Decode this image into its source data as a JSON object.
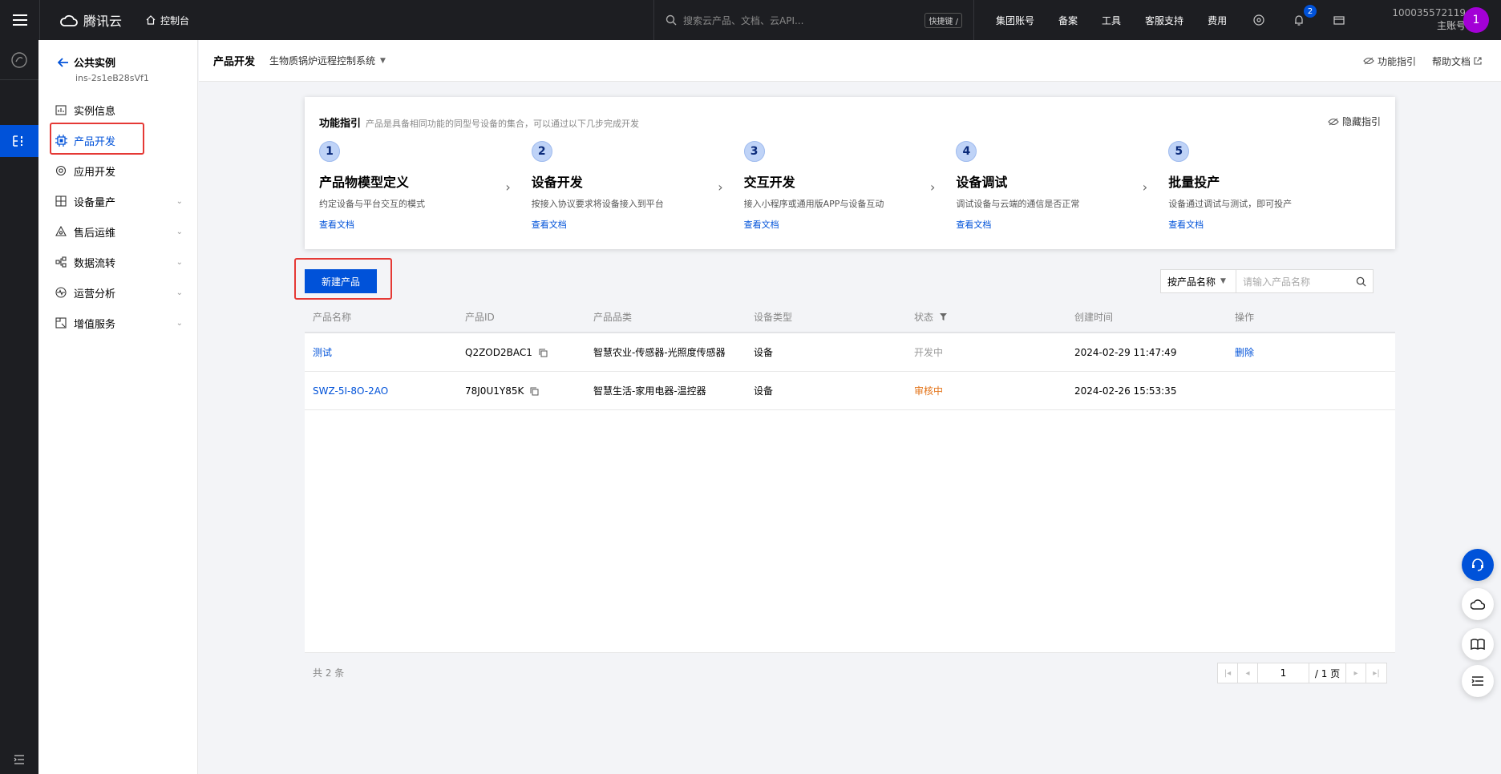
{
  "topbar": {
    "brand": "腾讯云",
    "console": "控制台",
    "search_placeholder": "搜索云产品、文档、云API...",
    "shortcut": "快捷键 /",
    "links": [
      "集团账号",
      "备案",
      "工具",
      "客服支持",
      "费用"
    ],
    "notification_count": "2",
    "account_id": "100035572119",
    "account_type": "主账号",
    "avatar_initial": "1"
  },
  "sidebar": {
    "title": "公共实例",
    "instance_id": "ins-2s1eB28sVf1",
    "items": [
      {
        "label": "实例信息",
        "icon": "chart-icon",
        "expandable": false
      },
      {
        "label": "产品开发",
        "icon": "chip-icon",
        "expandable": false,
        "active": true
      },
      {
        "label": "应用开发",
        "icon": "gear-icon",
        "expandable": false
      },
      {
        "label": "设备量产",
        "icon": "grid-icon",
        "expandable": true
      },
      {
        "label": "售后运维",
        "icon": "maintenance-icon",
        "expandable": true
      },
      {
        "label": "数据流转",
        "icon": "flow-icon",
        "expandable": true
      },
      {
        "label": "运营分析",
        "icon": "pulse-icon",
        "expandable": true
      },
      {
        "label": "增值服务",
        "icon": "service-icon",
        "expandable": true
      }
    ]
  },
  "header": {
    "title": "产品开发",
    "project": "生物质锅炉远程控制系统",
    "guide_link": "功能指引",
    "help_link": "帮助文档"
  },
  "guide": {
    "title": "功能指引",
    "desc": "产品是具备相同功能的同型号设备的集合，可以通过以下几步完成开发",
    "hide": "隐藏指引",
    "steps": [
      {
        "num": "1",
        "title": "产品物模型定义",
        "desc": "约定设备与平台交互的模式",
        "link": "查看文档"
      },
      {
        "num": "2",
        "title": "设备开发",
        "desc": "按接入协议要求将设备接入到平台",
        "link": "查看文档"
      },
      {
        "num": "3",
        "title": "交互开发",
        "desc": "接入小程序或通用版APP与设备互动",
        "link": "查看文档"
      },
      {
        "num": "4",
        "title": "设备调试",
        "desc": "调试设备与云端的通信是否正常",
        "link": "查看文档"
      },
      {
        "num": "5",
        "title": "批量投产",
        "desc": "设备通过调试与测试，即可投产",
        "link": "查看文档"
      }
    ]
  },
  "toolbar": {
    "new_product": "新建产品",
    "filter_select": "按产品名称",
    "filter_placeholder": "请输入产品名称"
  },
  "table": {
    "columns": [
      "产品名称",
      "产品ID",
      "产品品类",
      "设备类型",
      "状态",
      "创建时间",
      "操作"
    ],
    "rows": [
      {
        "name": "测试",
        "id": "Q2ZOD2BAC1",
        "category": "智慧农业-传感器-光照度传感器",
        "type": "设备",
        "status": "开发中",
        "created": "2024-02-29 11:47:49",
        "action": "删除"
      },
      {
        "name": "SWZ-5I-8O-2AO",
        "id": "78J0U1Y85K",
        "category": "智慧生活-家用电器-温控器",
        "type": "设备",
        "status": "审核中",
        "created": "2024-02-26 15:53:35",
        "action": ""
      }
    ]
  },
  "pagination": {
    "total": "共 2 条",
    "page": "1",
    "page_total": "/ 1 页"
  },
  "colors": {
    "primary": "#0052d9",
    "highlight": "#e53935",
    "reviewing": "#e37318"
  }
}
